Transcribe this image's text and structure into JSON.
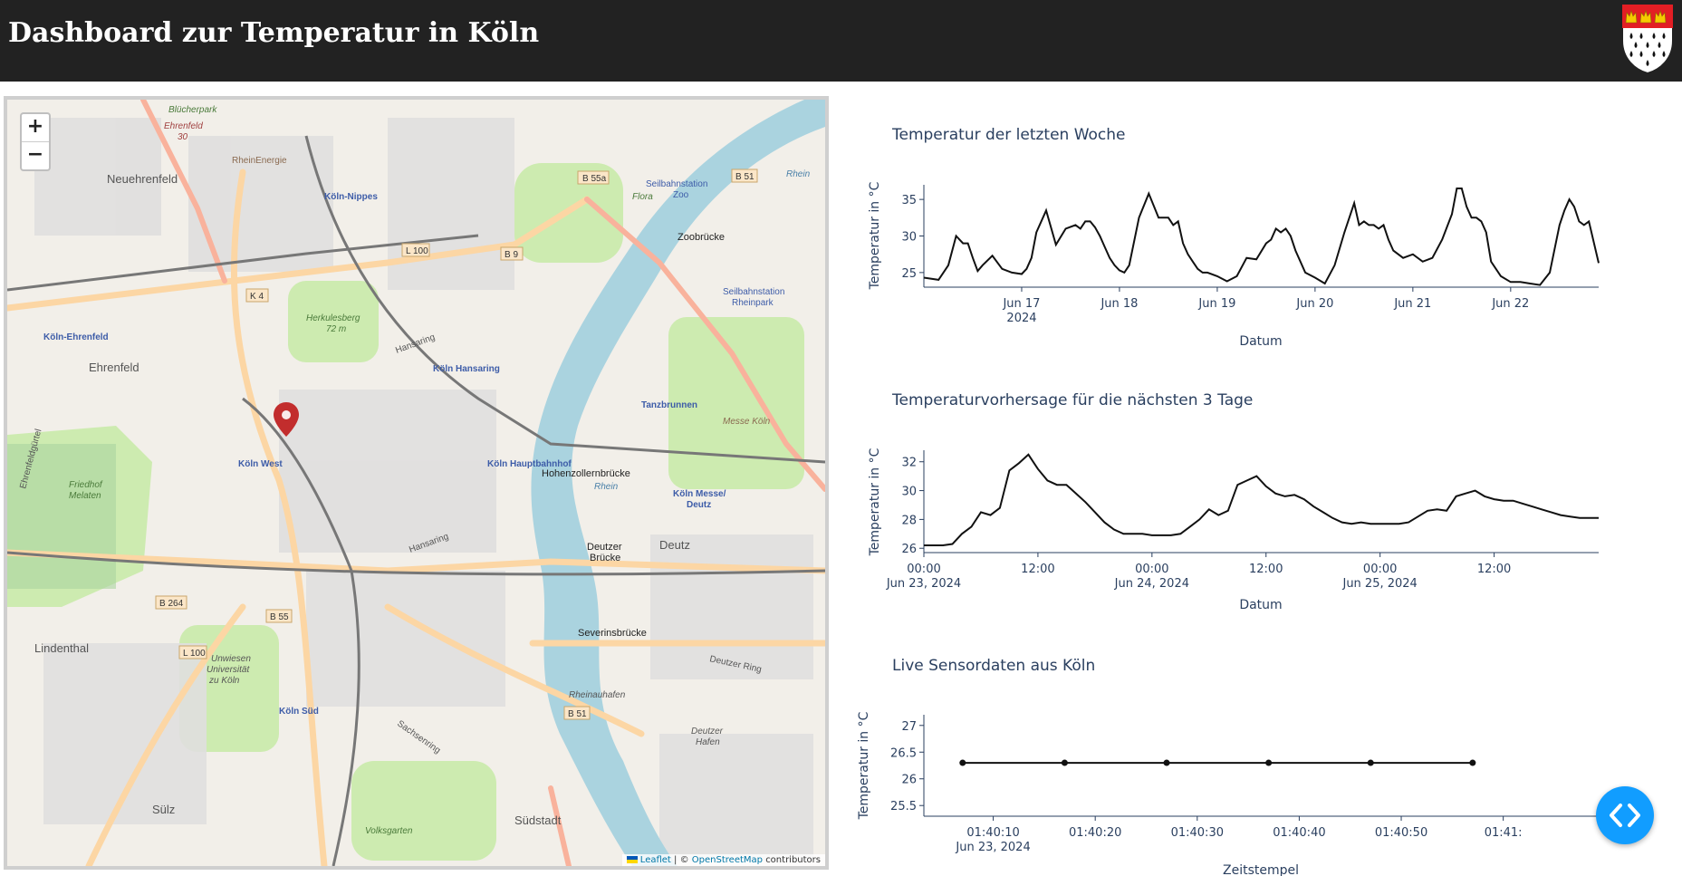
{
  "header": {
    "title": "Dashboard zur Temperatur in Köln"
  },
  "map": {
    "zoom_in": "+",
    "zoom_out": "−",
    "attribution": {
      "leaflet": "Leaflet",
      "separator": "| ©",
      "osm": "OpenStreetMap",
      "suffix": "contributors"
    },
    "labels": {
      "neuehrenfeld": "Neuehrenfeld",
      "ehrenfeld": "Ehrenfeld",
      "koeln_ehrenfeld": "Köln-Ehrenfeld",
      "koeln_nippes": "Köln-Nippes",
      "koeln_hansaring": "Köln Hansaring",
      "koeln_west": "Köln West",
      "koeln_hbf": "Köln Hauptbahnhof",
      "koeln_messe": "Köln Messe/",
      "deutz": "Deutz",
      "deutz2": "Deutz",
      "koeln_sued": "Köln Süd",
      "lindenthal": "Lindenthal",
      "suelz": "Sülz",
      "suedstadt": "Südstadt",
      "zoobruecke": "Zoobrücke",
      "hohenzollernbruecke": "Hohenzollernbrücke",
      "deutzer_bruecke": "Deutzer",
      "deutzer_bruecke2": "Brücke",
      "severinsbruecke": "Severinsbrücke",
      "tanzbrunnen": "Tanzbrunnen",
      "messe_koeln": "Messe Köln",
      "rhein": "Rhein",
      "rhein2": "Rhein",
      "friedhof": "Friedhof",
      "melaten": "Melaten",
      "herkulesberg": "Herkulesberg",
      "herkulesberg_h": "72 m",
      "volksgarten": "Volksgarten",
      "flora": "Flora",
      "rheinauhafen": "Rheinauhafen",
      "deutzer_hafen": "Deutzer",
      "deutzer_hafen2": "Hafen",
      "uni": "Unwiesen",
      "uni2": "Universität",
      "uni3": "zu Köln",
      "seilbahn_zoo": "Seilbahnstation",
      "seilbahn_zoo2": "Zoo",
      "seilbahn_rp": "Seilbahnstation",
      "seilbahn_rp2": "Rheinpark",
      "blucherpark": "Blücherpark",
      "ehrenfeld30": "Ehrenfeld",
      "ehrenfeld30b": "30",
      "rheinenergie": "RheinEnergie",
      "b55a": "B 55a",
      "b51": "B 51",
      "b51b": "B 51",
      "b9": "B 9",
      "l100": "L 100",
      "l100b": "L 100",
      "k4": "K 4",
      "b264": "B 264",
      "b55": "B 55",
      "hansaring": "Hansaring",
      "deutzer_ring": "Deutzer Ring",
      "sachsenring": "Sachsenring",
      "ehrenfeldguertel": "Ehrenfeldgürtel"
    }
  },
  "charts": {
    "week": {
      "title": "Temperatur der letzten Woche",
      "xlabel": "Datum",
      "ylabel": "Temperatur in °C",
      "x_ticks": [
        "Jun 17",
        "Jun 18",
        "Jun 19",
        "Jun 20",
        "Jun 21",
        "Jun 22"
      ],
      "x_subtick": "2024",
      "y_ticks": [
        25,
        30,
        35
      ]
    },
    "forecast": {
      "title": "Temperaturvorhersage für die nächsten 3 Tage",
      "xlabel": "Datum",
      "ylabel": "Temperatur in °C",
      "x_ticks": [
        "00:00",
        "12:00",
        "00:00",
        "12:00",
        "00:00",
        "12:00"
      ],
      "x_subticks": [
        "Jun 23, 2024",
        "Jun 24, 2024",
        "Jun 25, 2024"
      ],
      "y_ticks": [
        26,
        28,
        30,
        32
      ]
    },
    "live": {
      "title": "Live Sensordaten aus Köln",
      "xlabel": "Zeitstempel",
      "ylabel": "Temperatur in °C",
      "x_ticks": [
        "01:40:10",
        "01:40:20",
        "01:40:30",
        "01:40:40",
        "01:40:50",
        "01:41:"
      ],
      "x_subtick": "Jun 23, 2024",
      "y_ticks": [
        "25.5",
        "26",
        "26.5",
        "27"
      ]
    }
  },
  "chart_data": [
    {
      "type": "line",
      "title": "Temperatur der letzten Woche",
      "xlabel": "Datum",
      "ylabel": "Temperatur in °C",
      "x_unit": "days since Jun 16, 2024 00:00",
      "xlim": [
        0,
        6.9
      ],
      "ylim": [
        23,
        37
      ],
      "x": [
        0.0,
        0.15,
        0.25,
        0.33,
        0.4,
        0.45,
        0.5,
        0.55,
        0.6,
        0.7,
        0.8,
        0.9,
        1.0,
        1.05,
        1.1,
        1.15,
        1.25,
        1.35,
        1.45,
        1.55,
        1.6,
        1.65,
        1.7,
        1.75,
        1.8,
        1.85,
        1.9,
        1.95,
        2.0,
        2.05,
        2.1,
        2.2,
        2.3,
        2.4,
        2.5,
        2.55,
        2.6,
        2.65,
        2.7,
        2.75,
        2.8,
        2.85,
        2.9,
        3.0,
        3.1,
        3.2,
        3.3,
        3.4,
        3.5,
        3.55,
        3.6,
        3.65,
        3.7,
        3.75,
        3.8,
        3.9,
        4.0,
        4.1,
        4.2,
        4.3,
        4.4,
        4.45,
        4.5,
        4.55,
        4.6,
        4.65,
        4.7,
        4.75,
        4.8,
        4.9,
        5.0,
        5.1,
        5.2,
        5.3,
        5.4,
        5.45,
        5.5,
        5.55,
        5.6,
        5.65,
        5.7,
        5.75,
        5.8,
        5.9,
        6.0,
        6.1,
        6.2,
        6.3,
        6.4,
        6.5,
        6.55,
        6.6,
        6.65,
        6.7,
        6.75,
        6.8,
        6.9
      ],
      "y": [
        24.3,
        24.0,
        26.0,
        30.0,
        29.0,
        29.0,
        27.0,
        25.2,
        26.0,
        27.3,
        25.5,
        25.0,
        24.8,
        25.5,
        27.0,
        30.5,
        33.5,
        28.8,
        31.0,
        31.5,
        31.0,
        32.0,
        32.0,
        31.2,
        30.0,
        28.5,
        27.0,
        26.0,
        25.3,
        25.0,
        26.0,
        32.5,
        35.8,
        32.5,
        32.5,
        31.5,
        32.0,
        29.0,
        27.5,
        26.5,
        25.5,
        25.0,
        25.0,
        24.5,
        23.8,
        24.5,
        27.0,
        26.8,
        29.0,
        29.5,
        31.0,
        30.5,
        31.0,
        30.0,
        28.0,
        25.0,
        24.3,
        23.5,
        26.0,
        30.5,
        34.5,
        31.5,
        32.0,
        31.5,
        31.5,
        31.0,
        31.5,
        29.5,
        28.0,
        27.0,
        27.5,
        26.5,
        27.0,
        29.5,
        33.0,
        36.5,
        36.5,
        34.0,
        32.5,
        32.5,
        32.0,
        30.5,
        26.5,
        24.5,
        23.7,
        23.7,
        23.5,
        23.3,
        25.0,
        31.5,
        33.5,
        35.0,
        34.0,
        32.0,
        31.5,
        32.0,
        26.3
      ]
    },
    {
      "type": "line",
      "title": "Temperaturvorhersage für die nächsten 3 Tage",
      "xlabel": "Datum",
      "ylabel": "Temperatur in °C",
      "x_unit": "hours since Jun 23, 2024 00:00",
      "xlim": [
        0,
        71
      ],
      "ylim": [
        25.7,
        32.8
      ],
      "x": [
        0,
        1,
        2,
        3,
        4,
        5,
        6,
        7,
        8,
        9,
        10,
        11,
        12,
        13,
        14,
        15,
        16,
        17,
        18,
        19,
        20,
        21,
        22,
        23,
        24,
        25,
        26,
        27,
        28,
        29,
        30,
        31,
        32,
        33,
        34,
        35,
        36,
        37,
        38,
        39,
        40,
        41,
        42,
        43,
        44,
        45,
        46,
        47,
        48,
        49,
        50,
        51,
        52,
        53,
        54,
        55,
        56,
        57,
        58,
        59,
        60,
        61,
        62,
        63,
        64,
        65,
        66,
        67,
        68,
        69,
        70,
        71
      ],
      "y": [
        26.2,
        26.2,
        26.2,
        26.3,
        27.0,
        27.5,
        28.5,
        28.3,
        28.8,
        31.4,
        31.9,
        32.5,
        31.5,
        30.7,
        30.4,
        30.4,
        29.8,
        29.2,
        28.5,
        27.8,
        27.3,
        27.0,
        27.0,
        27.0,
        26.9,
        26.9,
        26.9,
        27.0,
        27.5,
        28.0,
        28.7,
        28.3,
        28.6,
        30.4,
        30.7,
        31.0,
        30.3,
        29.8,
        29.6,
        29.7,
        29.4,
        28.9,
        28.5,
        28.1,
        27.8,
        27.7,
        27.8,
        27.7,
        27.7,
        27.7,
        27.7,
        27.8,
        28.2,
        28.6,
        28.7,
        28.6,
        29.6,
        29.8,
        30.0,
        29.6,
        29.4,
        29.3,
        29.3,
        29.1,
        28.9,
        28.7,
        28.5,
        28.3,
        28.2,
        28.1,
        28.1,
        28.1
      ]
    },
    {
      "type": "scatter",
      "mode": "lines+markers",
      "title": "Live Sensordaten aus Köln",
      "xlabel": "Zeitstempel",
      "ylabel": "Temperatur in °C",
      "x": [
        "01:40:07",
        "01:40:17",
        "01:40:27",
        "01:40:37",
        "01:40:47",
        "01:40:57"
      ],
      "y": [
        26.3,
        26.3,
        26.3,
        26.3,
        26.3,
        26.3
      ],
      "ylim": [
        25.3,
        27.2
      ]
    }
  ]
}
